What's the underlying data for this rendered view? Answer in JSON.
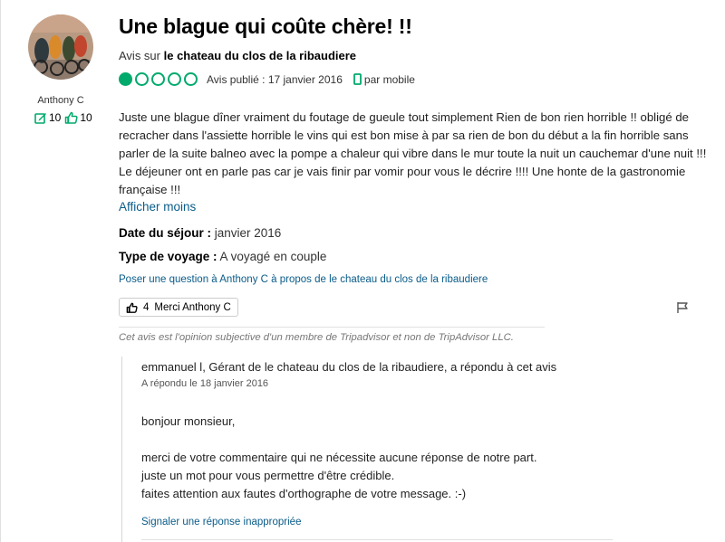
{
  "reviewer": {
    "name": "Anthony C",
    "contributions": "10",
    "helpful_votes": "10"
  },
  "review": {
    "title": "Une blague qui coûte chère! !!",
    "about_prefix": "Avis sur ",
    "about_place": "le chateau du clos de la ribaudiere",
    "rating": 1,
    "rating_max": 5,
    "published": "Avis publié : 17 janvier 2016",
    "device": "par mobile",
    "body": "Juste une blague dîner vraiment du foutage de gueule tout simplement Rien de bon rien horrible !! obligé de recracher dans l'assiette horrible le vins qui est bon mise à par sa rien de bon du début a la fin horrible sans parler de la suite balneo avec la pompe a chaleur qui vibre dans le mur toute la nuit un cauchemar d'une nuit !!! Le déjeuner ont en parle pas car je vais finir par vomir pour vous le décrire !!!! Une honte de la gastronomie française !!!",
    "read_less": "Afficher moins",
    "stay_label": "Date du séjour :",
    "stay_value": " janvier 2016",
    "trip_label": "Type de voyage :",
    "trip_value": " A voyagé en couple",
    "ask_question": "Poser une question à Anthony C à propos de le chateau du clos de la ribaudiere",
    "helpful_count": "4",
    "helpful_label": "Merci Anthony C",
    "disclaimer": "Cet avis est l'opinion subjective d'un membre de Tripadvisor et non de TripAdvisor LLC."
  },
  "response": {
    "header": "emmanuel l, Gérant de le chateau du clos de la ribaudiere, a répondu à cet avis",
    "date": "A répondu le 18 janvier 2016",
    "greeting": "bonjour monsieur,",
    "line1": "merci de votre commentaire qui ne nécessite aucune réponse de notre part.",
    "line2": "juste un mot pour vous permettre d'être crédible.",
    "line3": "faites attention aux fautes d'orthographe de votre message. :-)",
    "report": "Signaler une réponse inappropriée"
  },
  "colors": {
    "brand_green": "#00aa6c",
    "link_blue": "#0a5c89"
  },
  "icons": [
    "edit-icon",
    "thumbs-up-icon",
    "mobile-icon",
    "flag-icon"
  ]
}
